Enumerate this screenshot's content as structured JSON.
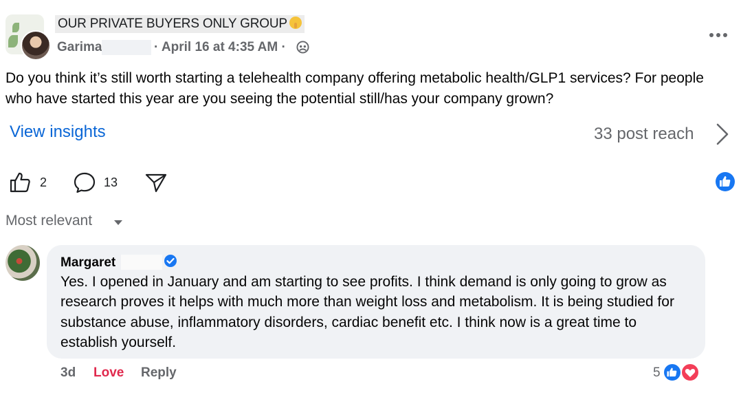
{
  "post": {
    "group_name": "OUR PRIVATE BUYERS ONLY GROUP",
    "author": "Garima",
    "meta": "· April 16 at 4:35 AM ·",
    "audience_icon": "members-globe-icon",
    "text": "Do you think it’s still worth starting a telehealth company offering metabolic health/GLP1 services? For people who have started this year are you seeing the potential still/has your company grown?",
    "insights_label": "View insights",
    "reach_label": "33 post reach"
  },
  "actions": {
    "like_count": "2",
    "comment_count": "13"
  },
  "sort": {
    "label": "Most relevant"
  },
  "comment": {
    "author": "Margaret",
    "text": "Yes. I opened in January and am starting to see profits. I think demand is only going to grow as research proves it helps with much more than weight loss and metabolism. It is being studied for substance abuse, inflammatory disorders, cardiac benefit etc. I think now is a great time to establish yourself.",
    "time": "3d",
    "love_label": "Love",
    "reply_label": "Reply",
    "reaction_count": "5"
  },
  "colors": {
    "link_blue": "#0a66d6",
    "fb_blue": "#1877f2",
    "love_red": "#e0294d",
    "secondary_text": "#65676b",
    "bubble_bg": "#f0f2f5"
  }
}
